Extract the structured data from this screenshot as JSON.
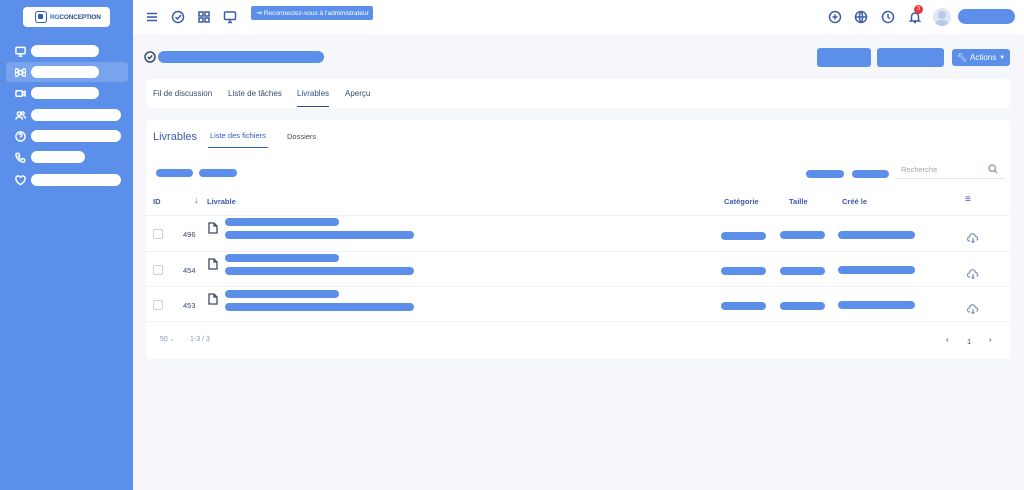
{
  "sidebar": {
    "logo_prefix": "RG",
    "logo_rest": "CONCEPTION",
    "items": [
      {
        "icon": "monitor-icon"
      },
      {
        "icon": "command-icon",
        "active": true
      },
      {
        "icon": "video-icon"
      },
      {
        "icon": "users-icon"
      },
      {
        "icon": "help-icon"
      },
      {
        "icon": "phone-icon"
      },
      {
        "icon": "heart-icon"
      }
    ]
  },
  "topbar": {
    "reconnect_label": "Reconnectez-vous à l'administrateur",
    "notification_count": "3"
  },
  "header": {
    "actions_label": "Actions"
  },
  "tabs": [
    "Fil de discussion",
    "Liste de tâches",
    "Livrables",
    "Aperçu"
  ],
  "content": {
    "title": "Livrables",
    "subtabs": [
      "Liste des fichiers",
      "Dossiers"
    ],
    "search_placeholder": "Recherche"
  },
  "table": {
    "headers": {
      "id": "ID",
      "livrable": "Livrable",
      "categorie": "Catégorie",
      "taille": "Taille",
      "cree": "Créé le"
    },
    "rows": [
      {
        "id": "496"
      },
      {
        "id": "454"
      },
      {
        "id": "453"
      }
    ]
  },
  "footer": {
    "page_size": "50",
    "range": "1-3 / 3",
    "page": "1"
  },
  "colors": {
    "accent": "#5b8fea",
    "sidebar": "#5b8fea",
    "badge": "#e5393a"
  }
}
